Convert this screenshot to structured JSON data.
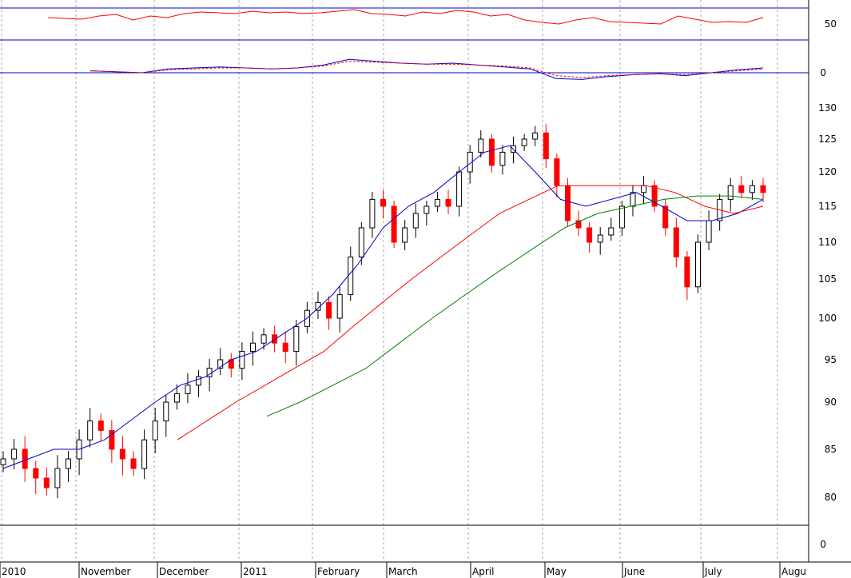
{
  "chart_data": [
    {
      "panel": "oscillator-1",
      "type": "line",
      "y_ticks": [
        50
      ],
      "ylim": [
        30,
        70
      ],
      "reference_lines": [
        30,
        70
      ],
      "series": [
        {
          "color": "#ff0000",
          "values": [
            58,
            57,
            56,
            60,
            62,
            55,
            60,
            58,
            63,
            65,
            64,
            63,
            66,
            64,
            65,
            63,
            64,
            66,
            68,
            63,
            62,
            60,
            65,
            63,
            67,
            65,
            60,
            62,
            55,
            52,
            50,
            55,
            58,
            53,
            52,
            51,
            50,
            60,
            56,
            52,
            53,
            52,
            58
          ]
        }
      ]
    },
    {
      "panel": "oscillator-2",
      "type": "line",
      "y_ticks": [
        0
      ],
      "ylim": [
        -5,
        30
      ],
      "reference_lines": [
        0
      ],
      "series": [
        {
          "color": "#0000cc",
          "values": [
            2,
            1,
            0,
            4,
            5,
            6,
            5,
            4,
            5,
            8,
            14,
            12,
            10,
            9,
            10,
            8,
            6,
            4,
            -6,
            -7,
            -4,
            -2,
            -1,
            -3,
            0,
            3,
            5
          ]
        },
        {
          "color": "#ff0000",
          "values": [
            2,
            1,
            0,
            3,
            4,
            5,
            5,
            4,
            5,
            7,
            12,
            11,
            10,
            9,
            9,
            8,
            7,
            5,
            -3,
            -5,
            -3,
            -2,
            -1,
            -2,
            0,
            2,
            4
          ]
        }
      ]
    },
    {
      "panel": "price",
      "type": "candlestick",
      "y_ticks": [
        80,
        85,
        90,
        95,
        100,
        105,
        110,
        115,
        120,
        125,
        130
      ],
      "ylim": [
        78,
        133
      ],
      "x_labels": [
        "2010",
        "November",
        "December",
        "2011",
        "February",
        "March",
        "April",
        "May",
        "June",
        "July",
        "Augu"
      ],
      "closes": [
        84,
        85,
        83,
        82,
        81,
        83,
        84,
        86,
        88,
        87,
        85,
        84,
        83,
        86,
        88,
        90,
        91,
        92,
        93,
        94,
        95,
        94,
        96,
        97,
        98,
        97,
        96,
        99,
        101,
        102,
        100,
        103,
        108,
        112,
        116,
        115,
        110,
        112,
        114,
        115,
        116,
        115,
        120,
        123,
        125,
        121,
        123,
        124,
        125,
        126,
        122,
        118,
        113,
        112,
        110,
        111,
        112,
        115,
        117,
        118,
        115,
        112,
        108,
        104,
        110,
        113,
        116,
        118,
        117,
        118,
        117
      ],
      "moving_averages": [
        {
          "color": "#0000cc",
          "values": [
            83,
            84,
            85,
            85,
            86,
            88,
            90,
            92,
            93,
            95,
            96,
            98,
            100,
            103,
            107,
            112,
            115,
            117,
            120,
            123,
            124,
            120,
            116,
            115,
            116,
            117,
            115,
            113,
            113,
            114,
            116
          ]
        },
        {
          "color": "#ff0000",
          "values": [
            86,
            88,
            90,
            92,
            94,
            96,
            99,
            102,
            105,
            108,
            111,
            114,
            116,
            118,
            118,
            118,
            118,
            117,
            115,
            114,
            115
          ]
        },
        {
          "color": "#008000",
          "values": [
            88.5,
            90,
            92,
            94,
            97,
            100,
            103,
            106,
            109,
            112,
            114,
            115,
            116,
            116.5,
            116.5,
            116
          ]
        }
      ]
    }
  ]
}
